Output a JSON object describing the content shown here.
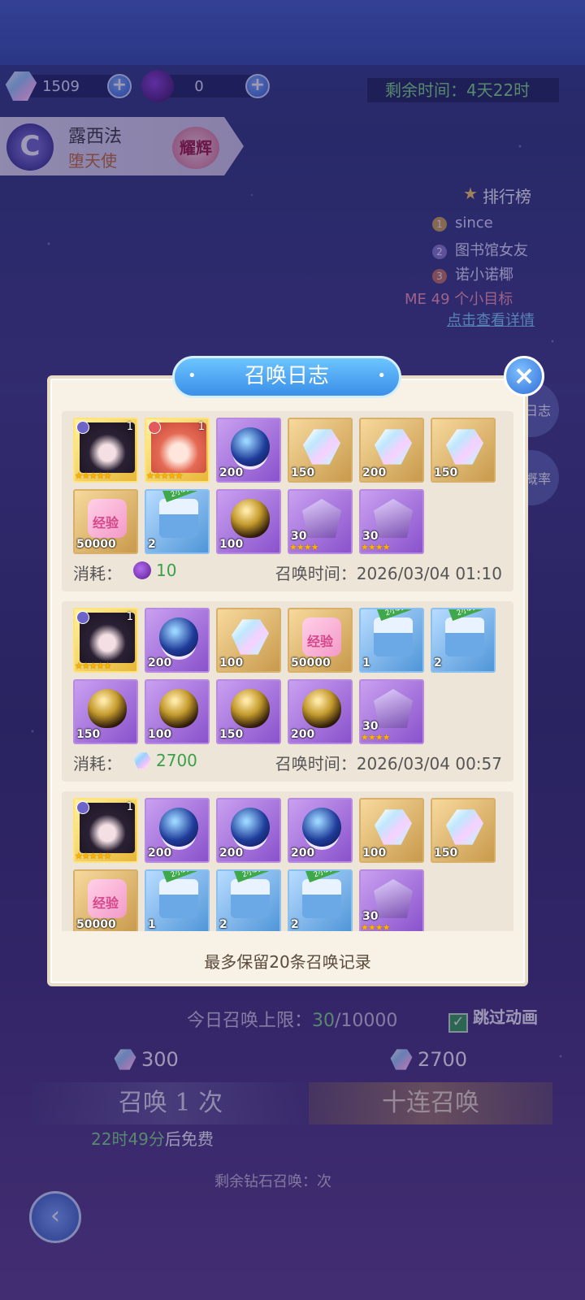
{
  "header": {
    "gems": "1509",
    "orbs": "0",
    "plus": "+",
    "timer": "剩余时间：4天22时"
  },
  "hero": {
    "name": "露西法",
    "title": "堕天使",
    "badge": "耀辉",
    "emblem": "C"
  },
  "ranking": {
    "title": "排行榜",
    "rows": [
      {
        "rank": "1",
        "name": "since"
      },
      {
        "rank": "2",
        "name": "图书馆女友"
      },
      {
        "rank": "3",
        "name": "诺小诺椰"
      }
    ],
    "me": "ME 49",
    "me_text": "个小目标",
    "detail_link": "点击查看详情"
  },
  "side": {
    "log": "日志",
    "rate": "概率"
  },
  "dialog": {
    "title": "召唤日志",
    "close": "×",
    "consume_label": "消耗：",
    "time_label": "召唤时间：",
    "note": "最多保留20条召唤记录",
    "time_tag": "2小时",
    "exp_text": "经验",
    "logs": [
      {
        "consume_icon": "orb",
        "consume": "10",
        "time": "2026/03/04 01:10",
        "items": [
          {
            "type": "hero-dark",
            "rarity": "hero",
            "level": "1",
            "stars": "★★★★★"
          },
          {
            "type": "hero-red",
            "rarity": "hero",
            "level": "1",
            "stars": "★★★★★"
          },
          {
            "type": "orb",
            "rarity": "purple",
            "qty": "200"
          },
          {
            "type": "gem",
            "rarity": "gold",
            "qty": "150"
          },
          {
            "type": "gem",
            "rarity": "gold",
            "qty": "200"
          },
          {
            "type": "gem",
            "rarity": "gold",
            "qty": "150"
          },
          {
            "type": "exp",
            "rarity": "gold",
            "qty": "50000"
          },
          {
            "type": "chest",
            "rarity": "blue",
            "qty": "2"
          },
          {
            "type": "egg",
            "rarity": "purple",
            "qty": "100"
          },
          {
            "type": "crystal",
            "rarity": "purple",
            "qty": "30",
            "stars": "★★★★"
          },
          {
            "type": "crystal",
            "rarity": "purple",
            "qty": "30",
            "stars": "★★★★"
          }
        ]
      },
      {
        "consume_icon": "gem",
        "consume": "2700",
        "time": "2026/03/04 00:57",
        "items": [
          {
            "type": "hero-dark",
            "rarity": "hero",
            "level": "1",
            "stars": "★★★★★"
          },
          {
            "type": "orb",
            "rarity": "purple",
            "qty": "200"
          },
          {
            "type": "gem",
            "rarity": "gold",
            "qty": "100"
          },
          {
            "type": "exp",
            "rarity": "gold",
            "qty": "50000"
          },
          {
            "type": "chest",
            "rarity": "blue",
            "qty": "1"
          },
          {
            "type": "chest",
            "rarity": "blue",
            "qty": "2"
          },
          {
            "type": "egg",
            "rarity": "purple",
            "qty": "150"
          },
          {
            "type": "egg",
            "rarity": "purple",
            "qty": "100"
          },
          {
            "type": "egg",
            "rarity": "purple",
            "qty": "150"
          },
          {
            "type": "egg",
            "rarity": "purple",
            "qty": "200"
          },
          {
            "type": "crystal",
            "rarity": "purple",
            "qty": "30",
            "stars": "★★★★"
          }
        ]
      },
      {
        "consume_icon": "gem",
        "consume": "",
        "time": "",
        "items": [
          {
            "type": "hero-dark",
            "rarity": "hero",
            "level": "1",
            "stars": "★★★★★"
          },
          {
            "type": "orb",
            "rarity": "purple",
            "qty": "200"
          },
          {
            "type": "orb",
            "rarity": "purple",
            "qty": "200"
          },
          {
            "type": "orb",
            "rarity": "purple",
            "qty": "200"
          },
          {
            "type": "gem",
            "rarity": "gold",
            "qty": "100"
          },
          {
            "type": "gem",
            "rarity": "gold",
            "qty": "150"
          },
          {
            "type": "exp",
            "rarity": "gold",
            "qty": "50000"
          },
          {
            "type": "chest",
            "rarity": "blue",
            "qty": "1"
          },
          {
            "type": "chest",
            "rarity": "blue",
            "qty": "2"
          },
          {
            "type": "chest",
            "rarity": "blue",
            "qty": "2"
          },
          {
            "type": "crystal",
            "rarity": "purple",
            "qty": "30",
            "stars": "★★★★"
          }
        ]
      }
    ]
  },
  "summon": {
    "daily_label": "今日召唤上限：",
    "daily_count": "30",
    "daily_max": "/10000",
    "skip_label": "跳过动画",
    "skip_check": "✓",
    "single_cost": "300",
    "ten_cost": "2700",
    "single_label": "召唤 1 次",
    "ten_label": "十连召唤",
    "free_time": "22时49分",
    "free_suffix": "后免费",
    "remaining_label": "剩余钻石召唤：",
    "remaining_count": "",
    "remaining_unit": "次",
    "back": "‹"
  }
}
